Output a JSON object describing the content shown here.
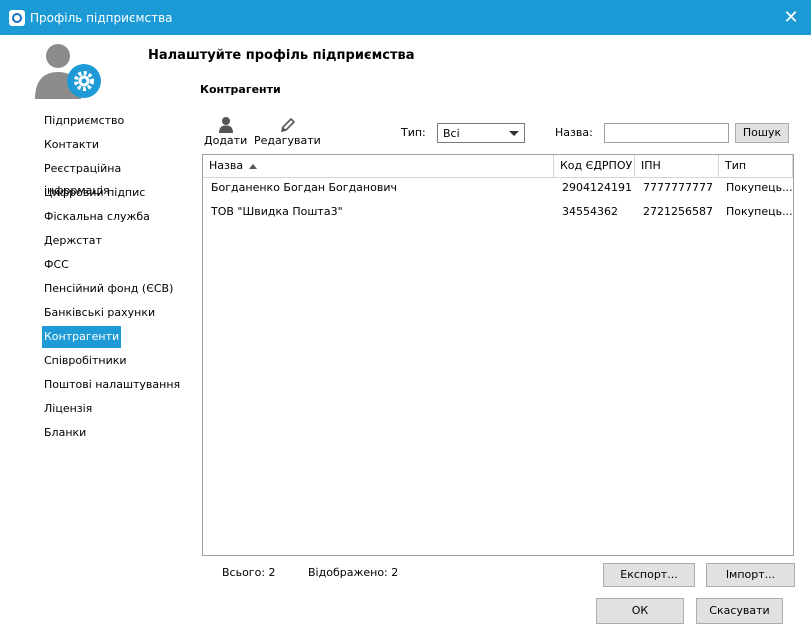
{
  "window": {
    "title": "Профіль підприємства",
    "close_glyph": "✕"
  },
  "header": {
    "title": "Налаштуйте профіль підприємства",
    "section": "Контрагенти"
  },
  "sidebar": {
    "items": [
      {
        "label": "Підприємство",
        "active": false
      },
      {
        "label": "Контакти",
        "active": false
      },
      {
        "label": "Реєстраційна інформація",
        "active": false
      },
      {
        "label": "Цифровий підпис",
        "active": false
      },
      {
        "label": "Фіскальна служба",
        "active": false
      },
      {
        "label": "Держстат",
        "active": false
      },
      {
        "label": "ФСС",
        "active": false
      },
      {
        "label": "Пенсійний фонд (ЄСВ)",
        "active": false
      },
      {
        "label": "Банківські рахунки",
        "active": false
      },
      {
        "label": "Контрагенти",
        "active": true
      },
      {
        "label": "Співробітники",
        "active": false
      },
      {
        "label": "Поштові налаштування",
        "active": false
      },
      {
        "label": "Ліцензія",
        "active": false
      },
      {
        "label": "Бланки",
        "active": false
      }
    ]
  },
  "toolbar": {
    "add_label": "Додати",
    "edit_label": "Редагувати"
  },
  "filters": {
    "type_label": "Тип:",
    "type_value": "Всі",
    "name_label": "Назва:",
    "name_value": "",
    "search_button": "Пошук"
  },
  "table": {
    "columns": [
      "Назва",
      "Код ЄДРПОУ",
      "ІПН",
      "Тип"
    ],
    "rows": [
      [
        "Богданенко Богдан Богданович",
        "2904124191",
        "7777777777",
        "Покупець..."
      ],
      [
        "ТОВ \"Швидка Пошта3\"",
        "34554362",
        "2721256587",
        "Покупець..."
      ]
    ]
  },
  "footer": {
    "total": "Всього: 2",
    "shown": "Відображено: 2",
    "export_button": "Експорт...",
    "import_button": "Імпорт...",
    "ok_button": "ОК",
    "cancel_button": "Скасувати"
  },
  "colors": {
    "titlebar": "#1b9ad5",
    "accent": "#1e9ad6"
  }
}
